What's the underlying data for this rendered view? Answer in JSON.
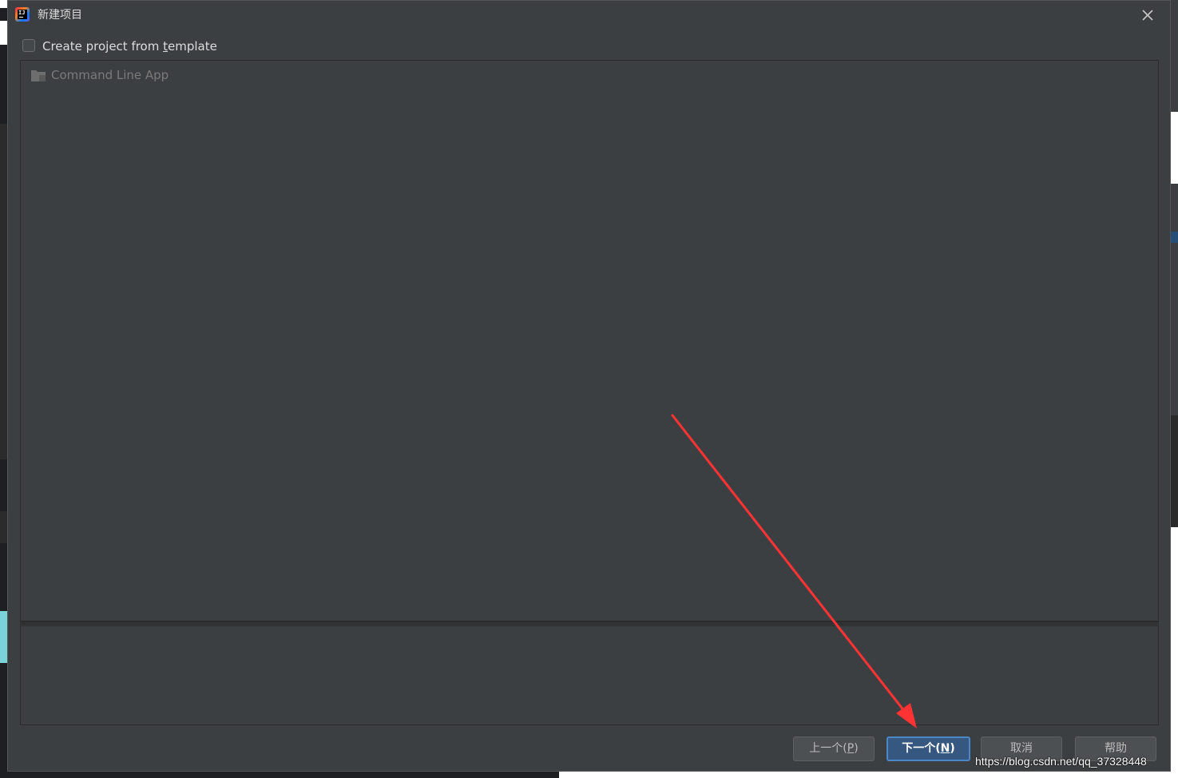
{
  "dialog": {
    "title": "新建项目",
    "app_icon": "intellij-idea-icon",
    "close_icon": "close-icon"
  },
  "template_checkbox": {
    "label_pre": "Create project from ",
    "label_mnemonic": "t",
    "label_post": "emplate",
    "checked": false
  },
  "template_list": {
    "items": [
      {
        "label": "Command Line App",
        "icon": "folder-icon",
        "enabled": false
      }
    ]
  },
  "buttons": {
    "prev": {
      "label": "上一个(",
      "mnemonic": "P",
      "suffix": ")"
    },
    "next": {
      "label": "下一个(",
      "mnemonic": "N",
      "suffix": ")"
    },
    "cancel": {
      "label": "取消"
    },
    "help": {
      "label": "帮助"
    }
  },
  "annotation": {
    "color": "#ff3333",
    "points_to": "next-button"
  },
  "watermark": "https://blog.csdn.net/qq_37328448",
  "colors": {
    "dialog_bg": "#3c3f41",
    "primary_button": "#365880",
    "primary_border": "#4a88c7"
  }
}
